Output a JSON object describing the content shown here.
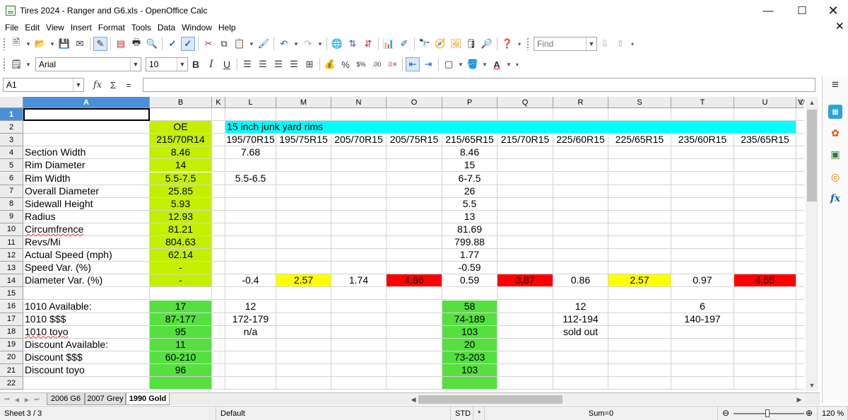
{
  "window": {
    "title": "Tires 2024 - Ranger and G6.xls - OpenOffice Calc",
    "minimize": "—",
    "maximize": "☐",
    "close": "✕"
  },
  "menu": [
    "File",
    "Edit",
    "View",
    "Insert",
    "Format",
    "Tools",
    "Data",
    "Window",
    "Help"
  ],
  "doc_close": "✕",
  "toolbar": {
    "find_placeholder": "Find",
    "font_name": "Arial",
    "font_size": "10",
    "bold": "B",
    "italic": "I",
    "underline": "U"
  },
  "formula": {
    "name_box": "A1",
    "fx": "fx",
    "sum": "Σ",
    "equals": "=",
    "value": ""
  },
  "sheet": {
    "columns": [
      "A",
      "B",
      "K",
      "L",
      "M",
      "N",
      "O",
      "P",
      "Q",
      "R",
      "S",
      "T",
      "U",
      "V"
    ],
    "active_column": "A",
    "rows": [
      "1",
      "2",
      "3",
      "4",
      "5",
      "6",
      "7",
      "8",
      "9",
      "10",
      "11",
      "12",
      "13",
      "14",
      "15",
      "16",
      "17",
      "18",
      "19",
      "20",
      "21",
      "22"
    ],
    "active_row": "1",
    "colors": {
      "lime": "#c4f000",
      "green": "#55e040",
      "cyan": "#00ffff",
      "yellow": "#ffff00",
      "red": "#ff0000"
    },
    "cells": [
      {
        "id": "B2",
        "text": "OE"
      },
      {
        "id": "L2",
        "text": "15 inch junk yard rims"
      },
      {
        "id": "B3",
        "text": "215/70R14"
      },
      {
        "id": "L3",
        "text": "195/70R15"
      },
      {
        "id": "M3",
        "text": "195/75R15"
      },
      {
        "id": "N3",
        "text": "205/70R15"
      },
      {
        "id": "O3",
        "text": "205/75R15"
      },
      {
        "id": "P3",
        "text": "215/65R15"
      },
      {
        "id": "Q3",
        "text": "215/70R15"
      },
      {
        "id": "R3",
        "text": "225/60R15"
      },
      {
        "id": "S3",
        "text": "225/65R15"
      },
      {
        "id": "T3",
        "text": "235/60R15"
      },
      {
        "id": "U3",
        "text": "235/65R15"
      },
      {
        "id": "A4",
        "text": "Section Width"
      },
      {
        "id": "B4",
        "text": "8.46"
      },
      {
        "id": "L4",
        "text": "7.68"
      },
      {
        "id": "P4",
        "text": "8.46"
      },
      {
        "id": "A5",
        "text": "Rim Diameter"
      },
      {
        "id": "B5",
        "text": "14"
      },
      {
        "id": "P5",
        "text": "15"
      },
      {
        "id": "A6",
        "text": "Rim Width"
      },
      {
        "id": "B6",
        "text": "5.5-7.5"
      },
      {
        "id": "L6",
        "text": "5.5-6.5"
      },
      {
        "id": "P6",
        "text": "6-7.5"
      },
      {
        "id": "A7",
        "text": "Overall Diameter"
      },
      {
        "id": "B7",
        "text": "25.85"
      },
      {
        "id": "P7",
        "text": "26"
      },
      {
        "id": "A8",
        "text": "Sidewall Height"
      },
      {
        "id": "B8",
        "text": "5.93"
      },
      {
        "id": "P8",
        "text": "5.5"
      },
      {
        "id": "A9",
        "text": "Radius"
      },
      {
        "id": "B9",
        "text": "12.93"
      },
      {
        "id": "P9",
        "text": "13"
      },
      {
        "id": "A10",
        "text": "Circumfrence"
      },
      {
        "id": "B10",
        "text": "81.21"
      },
      {
        "id": "P10",
        "text": "81.69"
      },
      {
        "id": "A11",
        "text": "Revs/Mi"
      },
      {
        "id": "B11",
        "text": "804.63"
      },
      {
        "id": "P11",
        "text": "799.88"
      },
      {
        "id": "A12",
        "text": "Actual Speed (mph)"
      },
      {
        "id": "B12",
        "text": "62.14"
      },
      {
        "id": "P12",
        "text": "1.77"
      },
      {
        "id": "A13",
        "text": "Speed Var. (%)"
      },
      {
        "id": "B13",
        "text": "-"
      },
      {
        "id": "P13",
        "text": "-0.59"
      },
      {
        "id": "A14",
        "text": "Diameter Var. (%)"
      },
      {
        "id": "B14",
        "text": "-"
      },
      {
        "id": "L14",
        "text": "-0.4"
      },
      {
        "id": "M14",
        "text": "2.57"
      },
      {
        "id": "N14",
        "text": "1.74"
      },
      {
        "id": "O14",
        "text": "4.86"
      },
      {
        "id": "P14",
        "text": "0.59"
      },
      {
        "id": "Q14",
        "text": "3.87"
      },
      {
        "id": "R14",
        "text": "0.86"
      },
      {
        "id": "S14",
        "text": "2.57"
      },
      {
        "id": "T14",
        "text": "0.97"
      },
      {
        "id": "U14",
        "text": "4.55"
      },
      {
        "id": "A16",
        "text": "1010 Available:"
      },
      {
        "id": "B16",
        "text": "17"
      },
      {
        "id": "L16",
        "text": "12"
      },
      {
        "id": "P16",
        "text": "58"
      },
      {
        "id": "R16",
        "text": "12"
      },
      {
        "id": "T16",
        "text": "6"
      },
      {
        "id": "A17",
        "text": "1010 $$$"
      },
      {
        "id": "B17",
        "text": "87-177"
      },
      {
        "id": "L17",
        "text": "172-179"
      },
      {
        "id": "P17",
        "text": "74-189"
      },
      {
        "id": "R17",
        "text": "112-194"
      },
      {
        "id": "T17",
        "text": "140-197"
      },
      {
        "id": "A18",
        "text": "1010 toyo"
      },
      {
        "id": "B18",
        "text": "95"
      },
      {
        "id": "L18",
        "text": "n/a"
      },
      {
        "id": "P18",
        "text": "103"
      },
      {
        "id": "R18",
        "text": "sold out"
      },
      {
        "id": "A19",
        "text": "Discount Available:"
      },
      {
        "id": "B19",
        "text": "11"
      },
      {
        "id": "P19",
        "text": "20"
      },
      {
        "id": "A20",
        "text": "Discount $$$"
      },
      {
        "id": "B20",
        "text": "60-210"
      },
      {
        "id": "P20",
        "text": "73-203"
      },
      {
        "id": "A21",
        "text": "Discount toyo"
      },
      {
        "id": "B21",
        "text": "96"
      },
      {
        "id": "P21",
        "text": "103"
      }
    ]
  },
  "tabs": [
    "2006 G6",
    "2007 Grey",
    "1990 Gold"
  ],
  "active_tab": "1990 Gold",
  "status": {
    "sheet": "Sheet 3 / 3",
    "style": "Default",
    "mode": "STD",
    "modified": "*",
    "sum": "Sum=0",
    "zoom": "120 %"
  }
}
